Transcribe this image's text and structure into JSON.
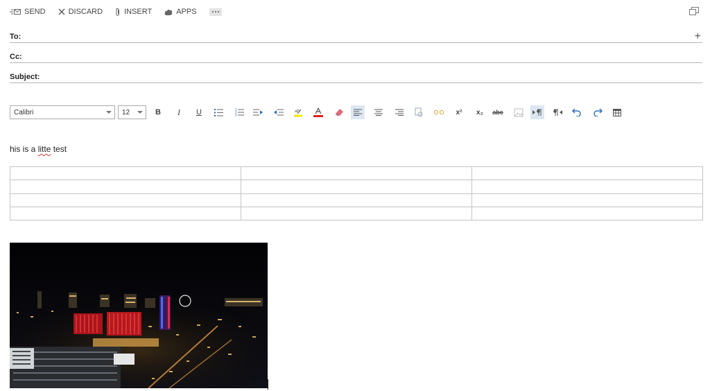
{
  "commands": {
    "send": "SEND",
    "discard": "DISCARD",
    "insert": "INSERT",
    "apps": "APPS"
  },
  "fields": {
    "to_label": "To:",
    "cc_label": "Cc:",
    "subject_label": "Subject:",
    "to_value": "",
    "cc_value": "",
    "subject_value": ""
  },
  "format": {
    "font_name": "Calibri",
    "font_size": "12",
    "bold": "B",
    "italic": "I",
    "underline": "U",
    "superscript": "x²",
    "subscript": "x₂",
    "strikethrough": "abc"
  },
  "message": {
    "before": "his is a ",
    "misspelled": "litte",
    "after": " test"
  },
  "table": {
    "rows": 4,
    "cols": 3
  },
  "colors": {
    "highlight": "#f5e400",
    "font_color": "#e0211d",
    "accent": "#2b6cb8"
  }
}
